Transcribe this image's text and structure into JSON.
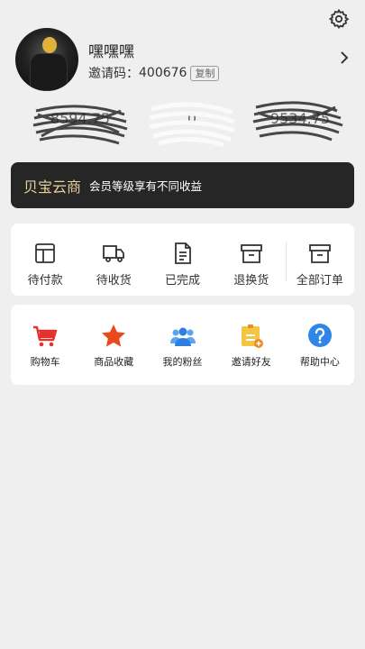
{
  "profile": {
    "name": "嘿嘿嘿",
    "invite_label": "邀请码：",
    "invite_code": "400676",
    "copy_label": "复制"
  },
  "stats": [
    {
      "value": "8594.75",
      "obscured": true
    },
    {
      "value": "0",
      "obscured": true
    },
    {
      "value": "9534.75",
      "obscured": true
    }
  ],
  "banner": {
    "brand": "贝宝云商",
    "text": "会员等级享有不同收益"
  },
  "orders": [
    {
      "label": "待付款",
      "icon": "wallet-icon"
    },
    {
      "label": "待收货",
      "icon": "truck-icon"
    },
    {
      "label": "已完成",
      "icon": "document-icon"
    },
    {
      "label": "退换货",
      "icon": "return-box-icon"
    },
    {
      "label": "全部订单",
      "icon": "box-icon"
    }
  ],
  "tools": [
    {
      "label": "购物车",
      "icon": "cart-icon",
      "color": "#e5322d"
    },
    {
      "label": "商品收藏",
      "icon": "star-icon",
      "color": "#e84a1b"
    },
    {
      "label": "我的粉丝",
      "icon": "fans-icon",
      "color": "#3d8ee8"
    },
    {
      "label": "邀请好友",
      "icon": "invite-icon",
      "color": "#f4c542"
    },
    {
      "label": "帮助中心",
      "icon": "help-icon",
      "color": "#2f86e6"
    }
  ]
}
